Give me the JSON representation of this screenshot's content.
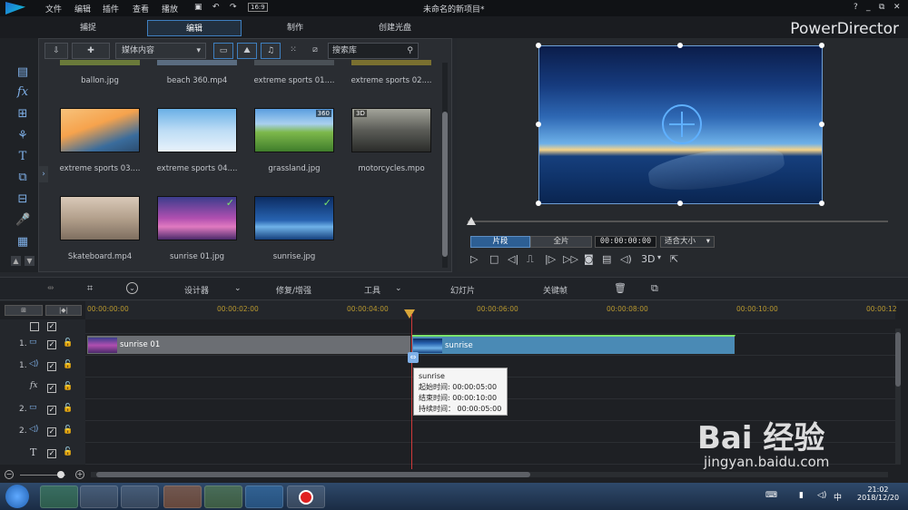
{
  "menu": [
    "文件",
    "编辑",
    "插件",
    "查看",
    "播放"
  ],
  "window_title": "未命名的新项目*",
  "window_controls": [
    "?",
    "_",
    "⧉",
    "✕"
  ],
  "brand": "PowerDirector",
  "tabs": [
    {
      "label": "捕捉",
      "active": false
    },
    {
      "label": "编辑",
      "active": true
    },
    {
      "label": "制作",
      "active": false
    },
    {
      "label": "创建光盘",
      "active": false
    }
  ],
  "library": {
    "filter": "媒体内容",
    "search_placeholder": "搜索库",
    "row0_captions": [
      "ballon.jpg",
      "beach 360.mp4",
      "extreme sports 01....",
      "extreme sports 02...."
    ],
    "items": [
      {
        "caption": "extreme sports 03....",
        "badge": "",
        "used": false
      },
      {
        "caption": "extreme sports 04....",
        "badge": "",
        "used": false
      },
      {
        "caption": "grassland.jpg",
        "badge": "360",
        "used": false
      },
      {
        "caption": "motorcycles.mpo",
        "badge": "3D",
        "used": false
      },
      {
        "caption": "Skateboard.mp4",
        "badge": "",
        "used": false
      },
      {
        "caption": "sunrise 01.jpg",
        "badge": "",
        "used": true
      },
      {
        "caption": "sunrise.jpg",
        "badge": "",
        "used": true
      }
    ]
  },
  "preview": {
    "mode_clip": "片段",
    "mode_full": "全片",
    "timecode": "00:00:00:00",
    "fit": "适合大小",
    "three_d": "3D"
  },
  "midbar": {
    "designer": "设计器",
    "fix": "修复/增强",
    "tools": "工具",
    "slideshow": "幻灯片",
    "keyframe": "关键帧"
  },
  "ruler_ticks": [
    "00:00:00:00",
    "00:00:02:00",
    "00:00:04:00",
    "00:00:06:00",
    "00:00:08:00",
    "00:00:10:00",
    "00:00:12"
  ],
  "tracks": [
    {
      "label": ""
    },
    {
      "label": "1."
    },
    {
      "label": "1."
    },
    {
      "label": ""
    },
    {
      "label": "2."
    },
    {
      "label": "2."
    },
    {
      "label": ""
    }
  ],
  "clips": {
    "clip1": "sunrise 01",
    "clip2": "sunrise"
  },
  "tooltip": {
    "name": "sunrise",
    "start": "起始时间: 00:00:05:00",
    "end": "结束时间: 00:00:10:00",
    "duration": "持续时间：  00:00:05:00"
  },
  "taskbar": {
    "time": "21:02",
    "date": "2018/12/20"
  },
  "watermark": {
    "logo": "Bai 经验",
    "url": "jingyan.baidu.com"
  },
  "colors": {
    "accent": "#3f7fbf",
    "clip_gray": "#6b6e73",
    "clip_blue": "#4a8ab5",
    "check": "#7be36b"
  }
}
